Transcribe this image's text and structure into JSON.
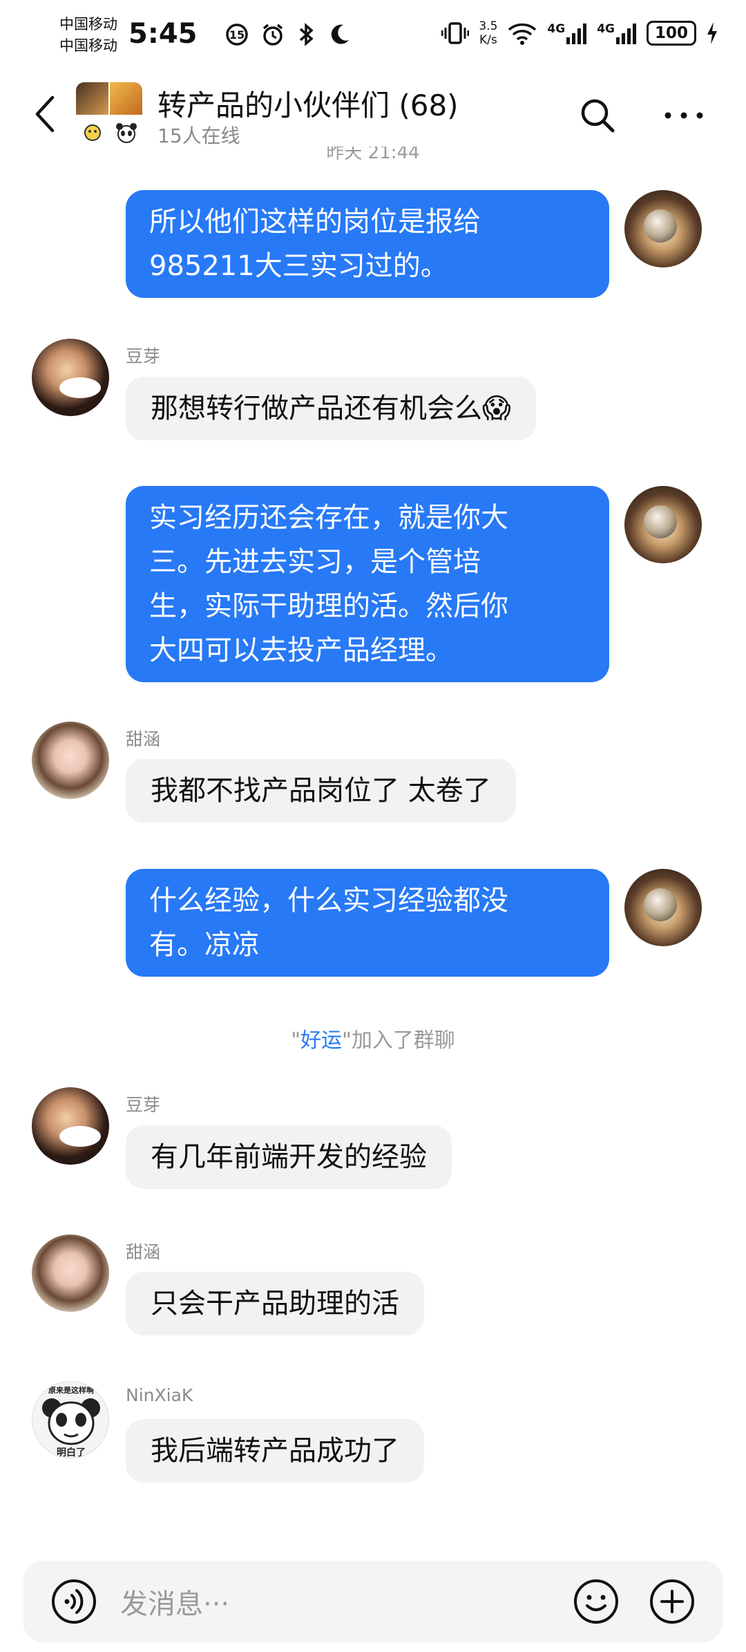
{
  "status": {
    "carrier1": "中国移动",
    "carrier2": "中国移动",
    "time": "5:45",
    "net_speed_value": "3.5",
    "net_speed_unit": "K/s",
    "net1": "4G",
    "net2": "4G",
    "battery": "100"
  },
  "header": {
    "title": "转产品的小伙伴们 (68)",
    "subtitle": "15人在线"
  },
  "timestamp_partial": "昨天 21:44",
  "messages": [
    {
      "side": "out",
      "lines": [
        "所以他们这样的岗位是报给",
        "985211大三实习过的。"
      ]
    },
    {
      "side": "in",
      "sender": "豆芽",
      "lines": [
        "那想转行做产品还有机会么😱"
      ]
    },
    {
      "side": "out",
      "lines": [
        "实习经历还会存在，就是你大",
        "三。先进去实习，是个管培",
        "生，实际干助理的活。然后你",
        "大四可以去投产品经理。"
      ]
    },
    {
      "side": "in",
      "sender": "甜涵",
      "lines": [
        "我都不找产品岗位了 太卷了"
      ]
    },
    {
      "side": "out",
      "lines": [
        "什么经验，什么实习经验都没",
        "有。凉凉"
      ]
    },
    {
      "side": "in",
      "sender": "豆芽",
      "lines": [
        "有几年前端开发的经验"
      ]
    },
    {
      "side": "in",
      "sender": "甜涵",
      "lines": [
        "只会干产品助理的活"
      ]
    },
    {
      "side": "in",
      "sender": "NinXiaK",
      "lines": [
        "我后端转产品成功了"
      ]
    }
  ],
  "system": {
    "quote_open": "\"",
    "name": "好运",
    "quote_close": "\"",
    "text": "加入了群聊"
  },
  "avatar_texts": {
    "nin_top": "原来是这样啊",
    "nin_bottom": "明白了"
  },
  "input": {
    "placeholder": "发消息···"
  },
  "colors": {
    "bubble_out": "#2779f6",
    "bubble_in": "#f2f2f2",
    "link": "#2779f6"
  }
}
